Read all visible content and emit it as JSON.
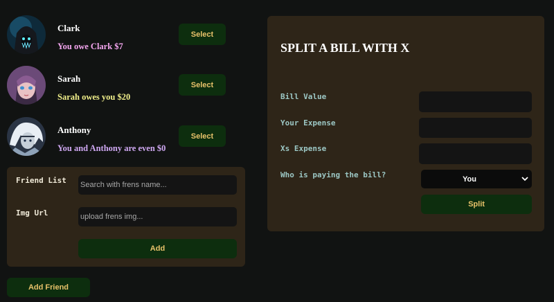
{
  "friends": [
    {
      "name": "Clark",
      "status": "You owe Clark $7",
      "status_color": "#f4a6ef",
      "select_label": "Select",
      "avatar_icon": "hooded-figure-avatar"
    },
    {
      "name": "Sarah",
      "status": "Sarah owes you $20",
      "status_color": "#f0ee8a",
      "select_label": "Select",
      "avatar_icon": "anime-girl-avatar"
    },
    {
      "name": "Anthony",
      "status": "You and Anthony are even $0",
      "status_color": "#cfa8f2",
      "select_label": "Select",
      "avatar_icon": "white-haired-warrior-avatar"
    }
  ],
  "add_friend_form": {
    "name_label": "Friend List",
    "name_placeholder": "Search with frens name...",
    "name_value": "",
    "url_label": "Img Url",
    "url_placeholder": "upload frens img...",
    "url_value": "",
    "add_label": "Add"
  },
  "add_friend_button": "Add Friend",
  "split_form": {
    "title": "SPLIT A BILL WITH X",
    "bill_value_label": "Bill Value",
    "bill_value": "",
    "your_expense_label": "Your Expense",
    "your_expense": "",
    "x_expense_label": "Xs Expense",
    "x_expense": "",
    "payer_label": "Who is paying the bill?",
    "payer_selected": "You",
    "split_label": "Split"
  },
  "colors": {
    "background": "#111312",
    "panel": "#2e2518",
    "button_bg": "#0d2e0e",
    "button_text": "#e8c26a",
    "input_bg": "#141414",
    "label_teal": "#9cc7c4"
  }
}
